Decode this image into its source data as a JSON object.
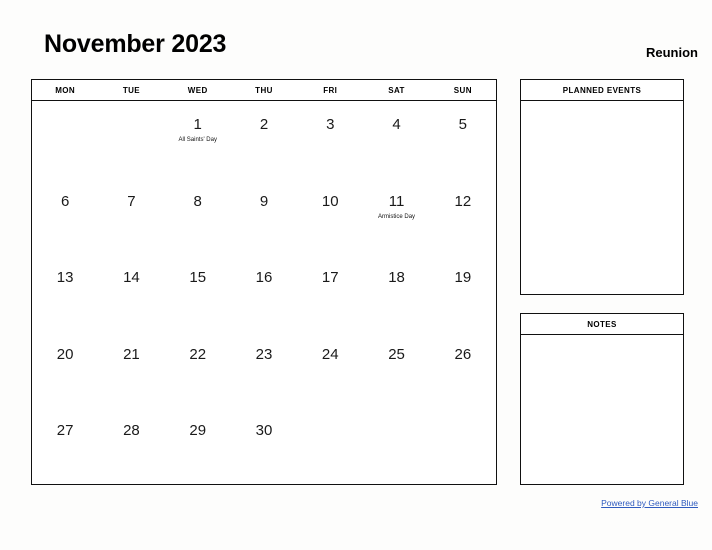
{
  "header": {
    "month_title": "November 2023",
    "region": "Reunion"
  },
  "calendar": {
    "weekdays": [
      "MON",
      "TUE",
      "WED",
      "THU",
      "FRI",
      "SAT",
      "SUN"
    ],
    "weeks": [
      [
        {
          "day": "",
          "event": ""
        },
        {
          "day": "",
          "event": ""
        },
        {
          "day": "1",
          "event": "All Saints' Day"
        },
        {
          "day": "2",
          "event": ""
        },
        {
          "day": "3",
          "event": ""
        },
        {
          "day": "4",
          "event": ""
        },
        {
          "day": "5",
          "event": ""
        }
      ],
      [
        {
          "day": "6",
          "event": ""
        },
        {
          "day": "7",
          "event": ""
        },
        {
          "day": "8",
          "event": ""
        },
        {
          "day": "9",
          "event": ""
        },
        {
          "day": "10",
          "event": ""
        },
        {
          "day": "11",
          "event": "Armistice Day"
        },
        {
          "day": "12",
          "event": ""
        }
      ],
      [
        {
          "day": "13",
          "event": ""
        },
        {
          "day": "14",
          "event": ""
        },
        {
          "day": "15",
          "event": ""
        },
        {
          "day": "16",
          "event": ""
        },
        {
          "day": "17",
          "event": ""
        },
        {
          "day": "18",
          "event": ""
        },
        {
          "day": "19",
          "event": ""
        }
      ],
      [
        {
          "day": "20",
          "event": ""
        },
        {
          "day": "21",
          "event": ""
        },
        {
          "day": "22",
          "event": ""
        },
        {
          "day": "23",
          "event": ""
        },
        {
          "day": "24",
          "event": ""
        },
        {
          "day": "25",
          "event": ""
        },
        {
          "day": "26",
          "event": ""
        }
      ],
      [
        {
          "day": "27",
          "event": ""
        },
        {
          "day": "28",
          "event": ""
        },
        {
          "day": "29",
          "event": ""
        },
        {
          "day": "30",
          "event": ""
        },
        {
          "day": "",
          "event": ""
        },
        {
          "day": "",
          "event": ""
        },
        {
          "day": "",
          "event": ""
        }
      ]
    ]
  },
  "panels": [
    {
      "id": "panel-events",
      "title": "PLANNED EVENTS",
      "content": ""
    },
    {
      "id": "panel-notes",
      "title": "NOTES",
      "content": ""
    }
  ],
  "footer": {
    "link_label": "Powered by General Blue",
    "link_color": "#2f5bbf"
  }
}
